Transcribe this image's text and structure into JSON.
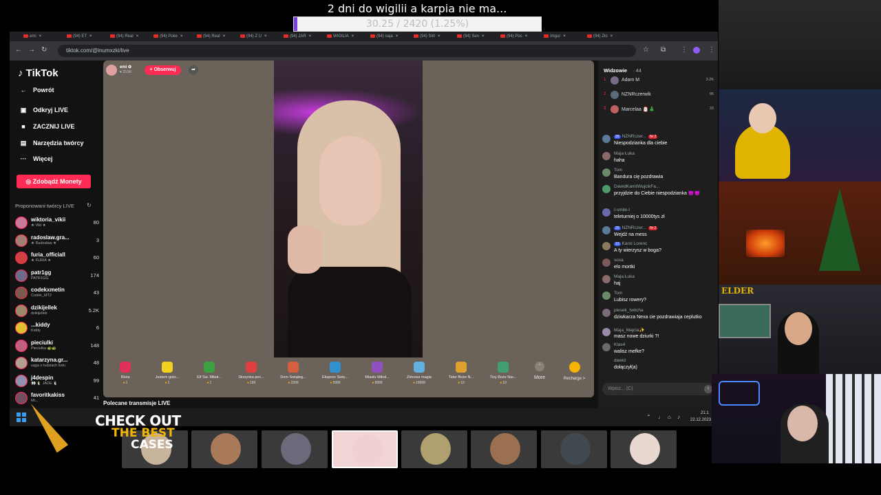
{
  "overlay": {
    "goal_title": "2 dni do wigilii a karpia nie ma...",
    "goal_progress": "30.25 / 2420 (1.25%)",
    "goal_fraction": 0.0125,
    "accent": "#7a3fe0"
  },
  "browser": {
    "tabs": [
      "emi",
      "(94) ET",
      "(94) Real",
      "(94) Poke",
      "(94) Real",
      "(94) Z U",
      "(94) JAR",
      "WIGILIA",
      "(94) naja",
      "(94) SW",
      "(94) Sen",
      "(94) Poc",
      "Imgur",
      "(94) Zło"
    ],
    "url": "tiktok.com/@inumxzki/live"
  },
  "sidebar": {
    "logo": "TikTok",
    "nav": [
      {
        "label": "Powrót",
        "icon": "back-arrow-icon"
      },
      {
        "label": "Odkryj LIVE",
        "icon": "live-tv-icon"
      },
      {
        "label": "ZACZNIJ LIVE",
        "icon": "camera-icon"
      },
      {
        "label": "Narzędzia twórcy",
        "icon": "tools-icon"
      },
      {
        "label": "Więcej",
        "icon": "more-dots-icon"
      }
    ],
    "coins_button": "Zdobądź Monety",
    "suggested_title": "Proponowani twórcy LIVE",
    "creators": [
      {
        "name": "wiktoria_vikii",
        "sub": "★ Viki ★",
        "count": "80"
      },
      {
        "name": "radoslaw.gra...",
        "sub": "★ Radosław ★",
        "count": "3"
      },
      {
        "name": "furia_officiall",
        "sub": "★ FURIA ★",
        "count": "60"
      },
      {
        "name": "patr1gg",
        "sub": "PATR1GG",
        "count": "174"
      },
      {
        "name": "codekxmetin",
        "sub": "Codek_MT2",
        "count": "43"
      },
      {
        "name": "dzikijellek",
        "sub": "dzikijellek",
        "count": "5.2K"
      },
      {
        "name": "...kiddy",
        "sub": "Kiddy",
        "count": "6"
      },
      {
        "name": "pieciulki",
        "sub": "Pieciulka 🐢🐢",
        "count": "148"
      },
      {
        "name": "katarzyna.gr...",
        "sub": "saga o ludziach lodu",
        "count": "48"
      },
      {
        "name": "j4despin",
        "sub": "👀 🐧 JADE 🐧",
        "count": "99"
      },
      {
        "name": "favoritkakiss",
        "sub": "Mi...",
        "count": "41"
      }
    ]
  },
  "stream": {
    "host_name": "emi ✿",
    "host_likes": "♥ 23.5K",
    "follow_label": "+ Obserwuj",
    "gifts": [
      {
        "name": "Róża",
        "price": "1",
        "color": "#e0305a"
      },
      {
        "name": "Jestem goto...",
        "price": "1",
        "color": "#f4d020"
      },
      {
        "name": "Elf Św. Mikoł...",
        "price": "1",
        "color": "#3aa040"
      },
      {
        "name": "Skrzynka poc...",
        "price": "199",
        "color": "#e04040"
      },
      {
        "name": "Dom Świąteg...",
        "price": "2200",
        "color": "#d46040"
      },
      {
        "name": "Ekspres Świę...",
        "price": "5999",
        "color": "#3090d0"
      },
      {
        "name": "Miasto Mikoł...",
        "price": "9999",
        "color": "#9050c0"
      },
      {
        "name": "Zimowa magia",
        "price": "19999",
        "color": "#60b0e0"
      },
      {
        "name": "Tster Boże N...",
        "price": "10",
        "color": "#e0a030"
      },
      {
        "name": "Tiny Boże Nar...",
        "price": "10",
        "color": "#40a070"
      }
    ],
    "more_label": "More",
    "recharge_label": "Recharge >",
    "recommended_label": "Polecane transmisje LIVE"
  },
  "chat": {
    "viewers_title": "Widzowie",
    "viewers_count": "· 44",
    "viewers": [
      {
        "rank": "1",
        "name": "Adam M",
        "score": "3.2K"
      },
      {
        "rank": "2",
        "name": "NZNRczerwik",
        "score": "96"
      },
      {
        "rank": "3",
        "name": "Marcelaa 🎅🏻🎄",
        "score": "33"
      }
    ],
    "messages": [
      {
        "user": "NZNRczer...",
        "badge": "20",
        "badge2": "Nr 2",
        "text": "Niespodzianka dla ciebie"
      },
      {
        "user": "Maja Łuka",
        "badge": "",
        "badge2": "",
        "text": "haha"
      },
      {
        "user": "Tom",
        "badge": "",
        "badge2": "",
        "text": "Bandura cię pozdrawia"
      },
      {
        "user": "DawidKamilWujcikFa...",
        "badge": "",
        "badge2": "",
        "text": "przyjdzie do Ciebie niespodzianka 😈😈"
      },
      {
        "user": "I-smile-I",
        "badge": "",
        "badge2": "",
        "text": "teleturniej o 10000tys zł"
      },
      {
        "user": "NZNRczer...",
        "badge": "20",
        "badge2": "Nr 2",
        "text": "Wejdź na mess"
      },
      {
        "user": "Karol Lorenc",
        "badge": "10",
        "badge2": "",
        "text": "A ty wierzysz w boga?"
      },
      {
        "user": "sosa",
        "badge": "",
        "badge2": "",
        "text": "elo mortki"
      },
      {
        "user": "Maja Łuka",
        "badge": "",
        "badge2": "",
        "text": "haj"
      },
      {
        "user": "Tom",
        "badge": "",
        "badge2": "",
        "text": "Lubisz rowery?"
      },
      {
        "user": "piesek_twitcha",
        "badge": "",
        "badge2": "",
        "text": "dziwkarza Nexa cie pozdrawiaja ceplutko"
      },
      {
        "user": "Maja_Majcia✨",
        "badge": "",
        "badge2": "",
        "text": "masz nowe dziurki ?!"
      },
      {
        "user": "Klas4",
        "badge": "",
        "badge2": "",
        "text": "walisz mefke?"
      },
      {
        "user": "dawid",
        "badge": "",
        "badge2": "",
        "text": "dołączył(a)"
      }
    ],
    "input_placeholder": "Wpisz... (C)"
  },
  "taskbar": {
    "time": "21:1",
    "date": "22.12.2023"
  },
  "webcams": {
    "elder_label": "ELDER"
  },
  "promo": {
    "line1": "CHECK OUT",
    "line2": "THE BEST",
    "line3": "CASES"
  },
  "thumbnails": [
    "#c8b49c",
    "#a87a5a",
    "#6a6a7a",
    "#f0d0d0",
    "#b0a070",
    "#9a7050",
    "#404850",
    "#e8d8d0"
  ]
}
